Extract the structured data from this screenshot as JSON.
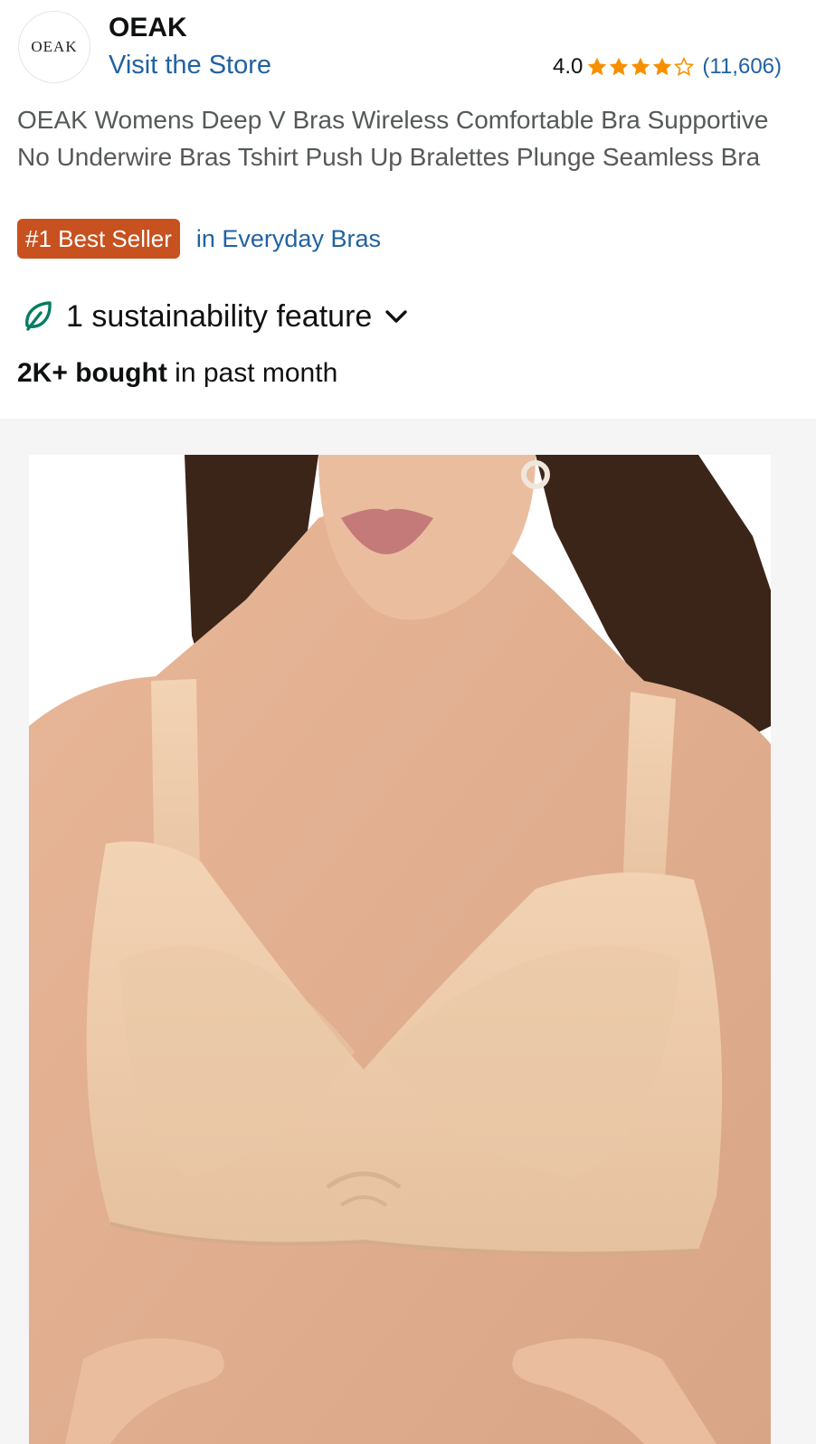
{
  "store": {
    "logo_text": "OEAK",
    "brand_name": "OEAK",
    "visit_store": "Visit the Store"
  },
  "rating": {
    "value": "4.0",
    "stars": 4,
    "max_stars": 5,
    "review_count": "(11,606)",
    "star_color": "#f79000"
  },
  "product": {
    "title": "OEAK Womens Deep V Bras Wireless Comfortable Bra Supportive No Underwire Bras Tshirt Push Up Bralettes Plunge Seamless Bra"
  },
  "badge": {
    "label": "#1 Best Seller",
    "category": "in Everyday Bras",
    "color": "#c7511f"
  },
  "sustainability": {
    "label": "1 sustainability feature",
    "icon": "leaf-icon",
    "expand_icon": "chevron-down-icon"
  },
  "purchases": {
    "bold": "2K+ bought",
    "rest": " in past month"
  },
  "colors": {
    "link": "#2162a1",
    "leaf": "#067d62"
  }
}
